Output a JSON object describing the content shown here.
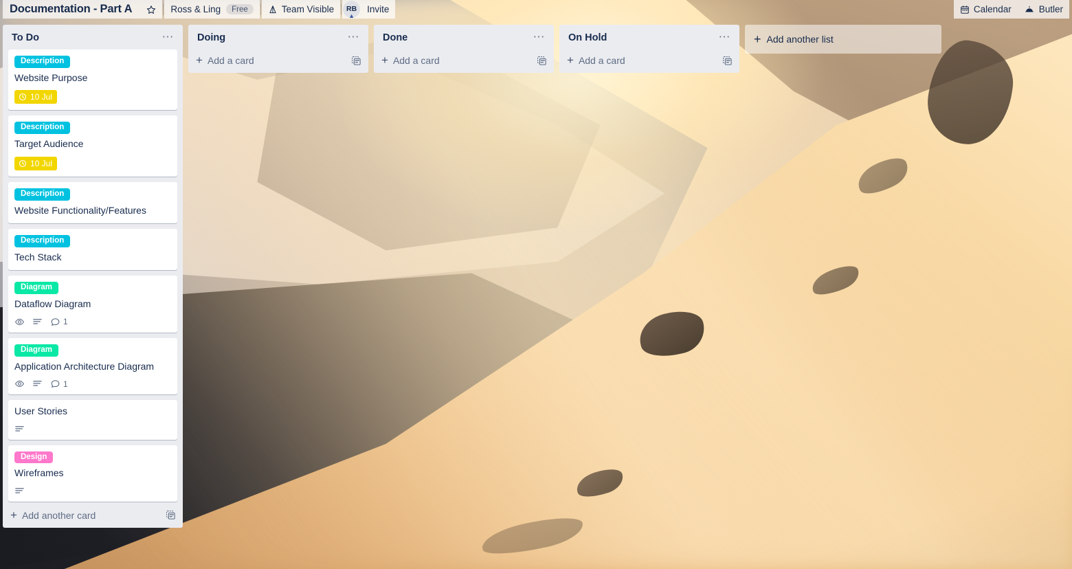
{
  "header": {
    "board_title": "Documentation - Part A",
    "star_icon": "star-icon",
    "workspace_name": "Ross & Ling",
    "plan_badge": "Free",
    "visibility_icon": "organization-icon",
    "visibility_label": "Team Visible",
    "avatar_initials": "RB",
    "invite_label": "Invite",
    "calendar_icon": "calendar-icon",
    "calendar_label": "Calendar",
    "butler_icon": "butler-icon",
    "butler_label": "Butler"
  },
  "colors": {
    "label_description": "#00c2e0",
    "label_diagram": "#0ae8a6",
    "label_design": "#ff78cb",
    "due_yellow": "#f2d600",
    "list_bg": "#ebecf0",
    "card_bg": "#ffffff",
    "text_primary": "#172b4d",
    "text_muted": "#5e6c84"
  },
  "board": {
    "add_list_label": "Add another list",
    "lists": [
      {
        "name": "To Do",
        "menu_icon": "list-actions-icon",
        "add_card_label": "Add another card",
        "card_template_icon": "card-template-icon",
        "cards": [
          {
            "title": "Website Purpose",
            "label": {
              "text": "Description",
              "color": "#00c2e0"
            },
            "due": {
              "text": "10 Jul",
              "icon": "clock-icon"
            },
            "badges": []
          },
          {
            "title": "Target Audience",
            "label": {
              "text": "Description",
              "color": "#00c2e0"
            },
            "due": {
              "text": "10 Jul",
              "icon": "clock-icon"
            },
            "badges": []
          },
          {
            "title": "Website Functionality/Features",
            "label": {
              "text": "Description",
              "color": "#00c2e0"
            },
            "due": null,
            "badges": []
          },
          {
            "title": "Tech Stack",
            "label": {
              "text": "Description",
              "color": "#00c2e0"
            },
            "due": null,
            "badges": []
          },
          {
            "title": "Dataflow Diagram",
            "label": {
              "text": "Diagram",
              "color": "#0ae8a6"
            },
            "due": null,
            "badges": [
              {
                "icon": "watch-eye-icon",
                "text": ""
              },
              {
                "icon": "description-lines-icon",
                "text": ""
              },
              {
                "icon": "comment-icon",
                "text": "1"
              }
            ]
          },
          {
            "title": "Application Architecture Diagram",
            "label": {
              "text": "Diagram",
              "color": "#0ae8a6"
            },
            "due": null,
            "badges": [
              {
                "icon": "watch-eye-icon",
                "text": ""
              },
              {
                "icon": "description-lines-icon",
                "text": ""
              },
              {
                "icon": "comment-icon",
                "text": "1"
              }
            ]
          },
          {
            "title": "User Stories",
            "label": null,
            "due": null,
            "badges": [
              {
                "icon": "description-lines-icon",
                "text": ""
              }
            ]
          },
          {
            "title": "Wireframes",
            "label": {
              "text": "Design",
              "color": "#ff78cb"
            },
            "due": null,
            "badges": [
              {
                "icon": "description-lines-icon",
                "text": ""
              }
            ]
          }
        ]
      },
      {
        "name": "Doing",
        "menu_icon": "list-actions-icon",
        "add_card_label": "Add a card",
        "card_template_icon": "card-template-icon",
        "cards": []
      },
      {
        "name": "Done",
        "menu_icon": "list-actions-icon",
        "add_card_label": "Add a card",
        "card_template_icon": "card-template-icon",
        "cards": []
      },
      {
        "name": "On Hold",
        "menu_icon": "list-actions-icon",
        "add_card_label": "Add a card",
        "card_template_icon": "card-template-icon",
        "cards": []
      }
    ]
  }
}
